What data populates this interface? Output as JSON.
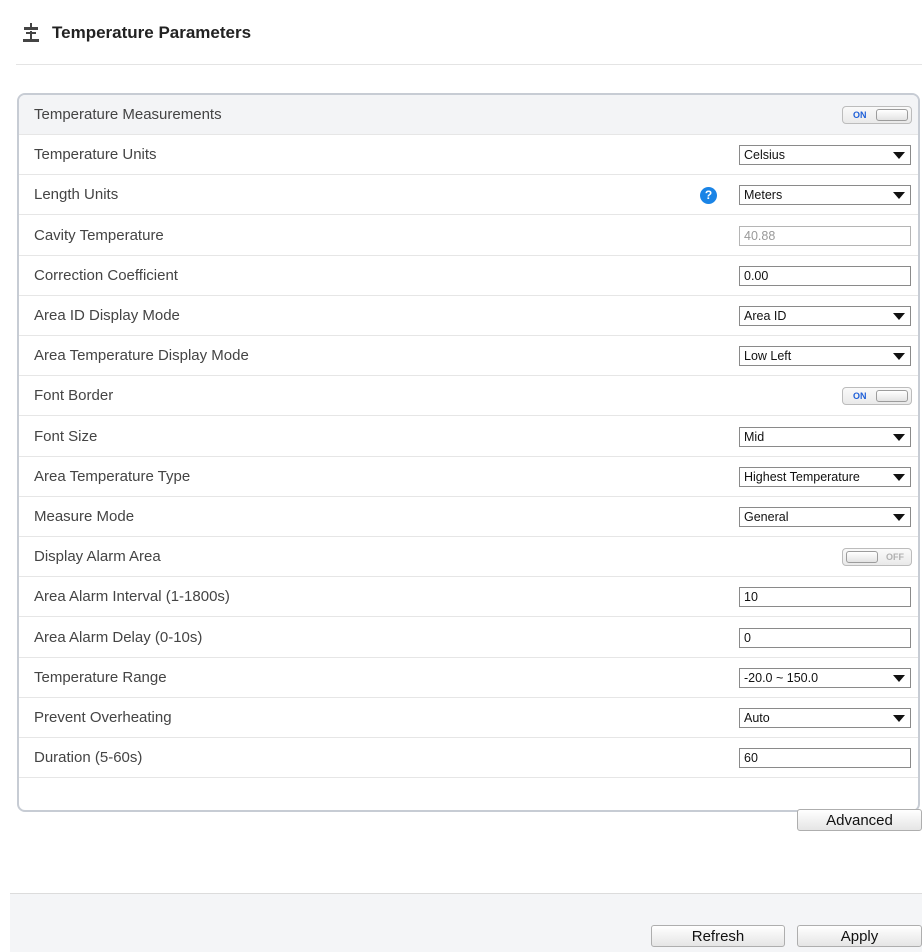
{
  "page": {
    "title": "Temperature Parameters",
    "icon": "thermometer-settings-icon"
  },
  "rows": [
    {
      "label": "Temperature Measurements",
      "type": "toggle",
      "state": "ON"
    },
    {
      "label": "Temperature Units",
      "type": "select",
      "value": "Celsius"
    },
    {
      "label": "Length Units",
      "type": "select",
      "value": "Meters",
      "help": "?"
    },
    {
      "label": "Cavity Temperature",
      "type": "input-disabled",
      "value": "40.88"
    },
    {
      "label": "Correction Coefficient",
      "type": "input",
      "value": "0.00"
    },
    {
      "label": "Area ID Display Mode",
      "type": "select",
      "value": "Area ID"
    },
    {
      "label": "Area Temperature Display Mode",
      "type": "select",
      "value": "Low Left"
    },
    {
      "label": "Font Border",
      "type": "toggle",
      "state": "ON"
    },
    {
      "label": "Font Size",
      "type": "select",
      "value": "Mid"
    },
    {
      "label": "Area Temperature Type",
      "type": "select",
      "value": "Highest Temperature"
    },
    {
      "label": "Measure Mode",
      "type": "select",
      "value": "General"
    },
    {
      "label": "Display Alarm Area",
      "type": "toggle",
      "state": "OFF"
    },
    {
      "label": "Area Alarm Interval (1-1800s)",
      "type": "input",
      "value": "10"
    },
    {
      "label": "Area Alarm Delay (0-10s)",
      "type": "input",
      "value": "0"
    },
    {
      "label": "Temperature Range",
      "type": "select",
      "value": "-20.0 ~ 150.0"
    },
    {
      "label": "Prevent Overheating",
      "type": "select",
      "value": "Auto"
    },
    {
      "label": "Duration (5-60s)",
      "type": "input",
      "value": "60"
    }
  ],
  "buttons": {
    "advanced": "Advanced",
    "refresh": "Refresh",
    "apply": "Apply"
  },
  "colors": {
    "help_icon": "#1a84e6",
    "toggle_on_text": "#1e5fd8",
    "panel_border": "#c7ccd4"
  }
}
